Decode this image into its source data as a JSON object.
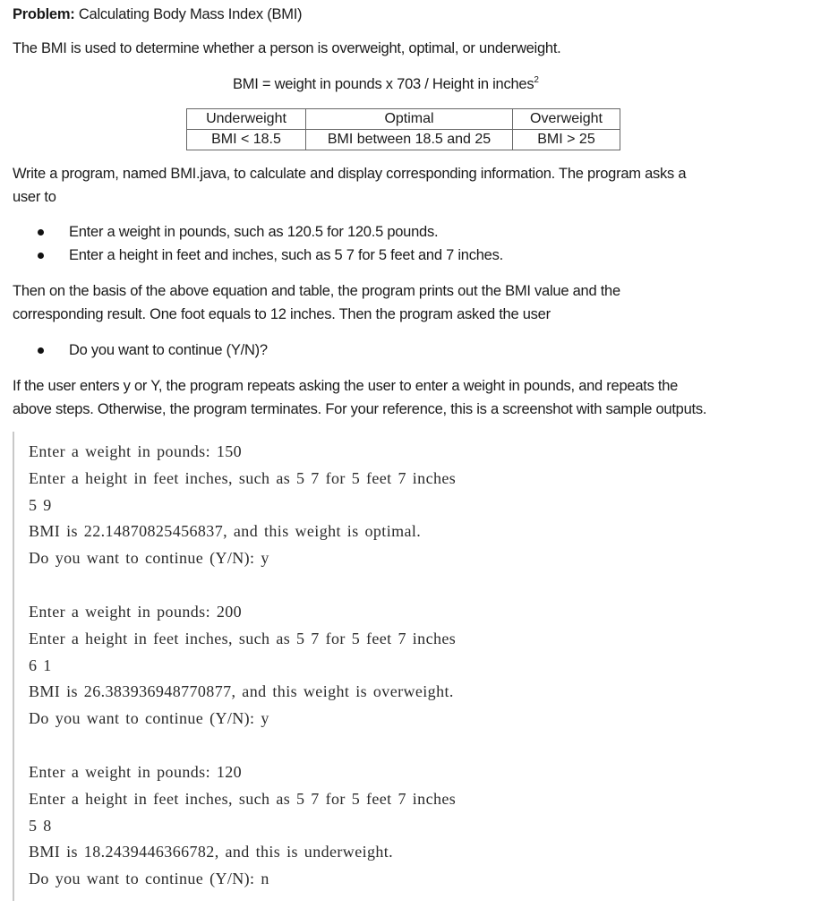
{
  "document": {
    "title_label": "Problem:",
    "title_text": " Calculating Body Mass Index (BMI)",
    "intro": "The BMI is used to determine whether a person is overweight, optimal, or underweight.",
    "formula": "BMI = weight in pounds x 703 / Height in inches",
    "formula_superscript": "2",
    "table": {
      "headers": [
        "Underweight",
        "Optimal",
        "Overweight"
      ],
      "rows": [
        [
          "BMI < 18.5",
          "BMI between 18.5 and 25",
          "BMI > 25"
        ]
      ]
    },
    "write_line1": "Write a program, named BMI.java, to calculate and display corresponding information. The program asks a",
    "write_line2": "user to",
    "bullets_input": [
      "Enter a weight in pounds, such as 120.5 for 120.5 pounds.",
      "Enter a height in feet and inches, such as 5 7 for 5 feet and 7 inches."
    ],
    "then_line1": "Then on the basis of the above equation and table, the program prints out the BMI value and the",
    "then_line2": "corresponding result. One foot equals to 12 inches. Then the program asked the user",
    "bullet_continue": "Do you want to continue (Y/N)?",
    "if_line1": "If the user enters y or Y, the program repeats asking the user to enter a weight in pounds, and repeats the",
    "if_line2": "above steps. Otherwise, the program terminates. For your reference, this is a screenshot with sample outputs."
  },
  "console": {
    "runs": [
      {
        "weight_prompt": "Enter a weight in pounds: 150",
        "height_prompt": "Enter a height in feet inches, such as 5 7 for 5 feet 7 inches",
        "height_input": "5 9",
        "result": "BMI is 22.14870825456837, and this weight is optimal.",
        "continue_prompt": "Do you want to continue (Y/N): y"
      },
      {
        "weight_prompt": "Enter a weight in pounds: 200",
        "height_prompt": "Enter a height in feet inches, such as 5 7 for 5 feet 7 inches",
        "height_input": "6 1",
        "result": "BMI is 26.383936948770877, and this weight is overweight.",
        "continue_prompt": "Do you want to continue (Y/N): y"
      },
      {
        "weight_prompt": "Enter a weight in pounds: 120",
        "height_prompt": "Enter a height in feet inches, such as 5 7 for 5 feet 7 inches",
        "height_input": "5 8",
        "result": "BMI is 18.2439446366782, and this is underweight.",
        "continue_prompt": "Do you want to continue (Y/N): n"
      }
    ]
  }
}
